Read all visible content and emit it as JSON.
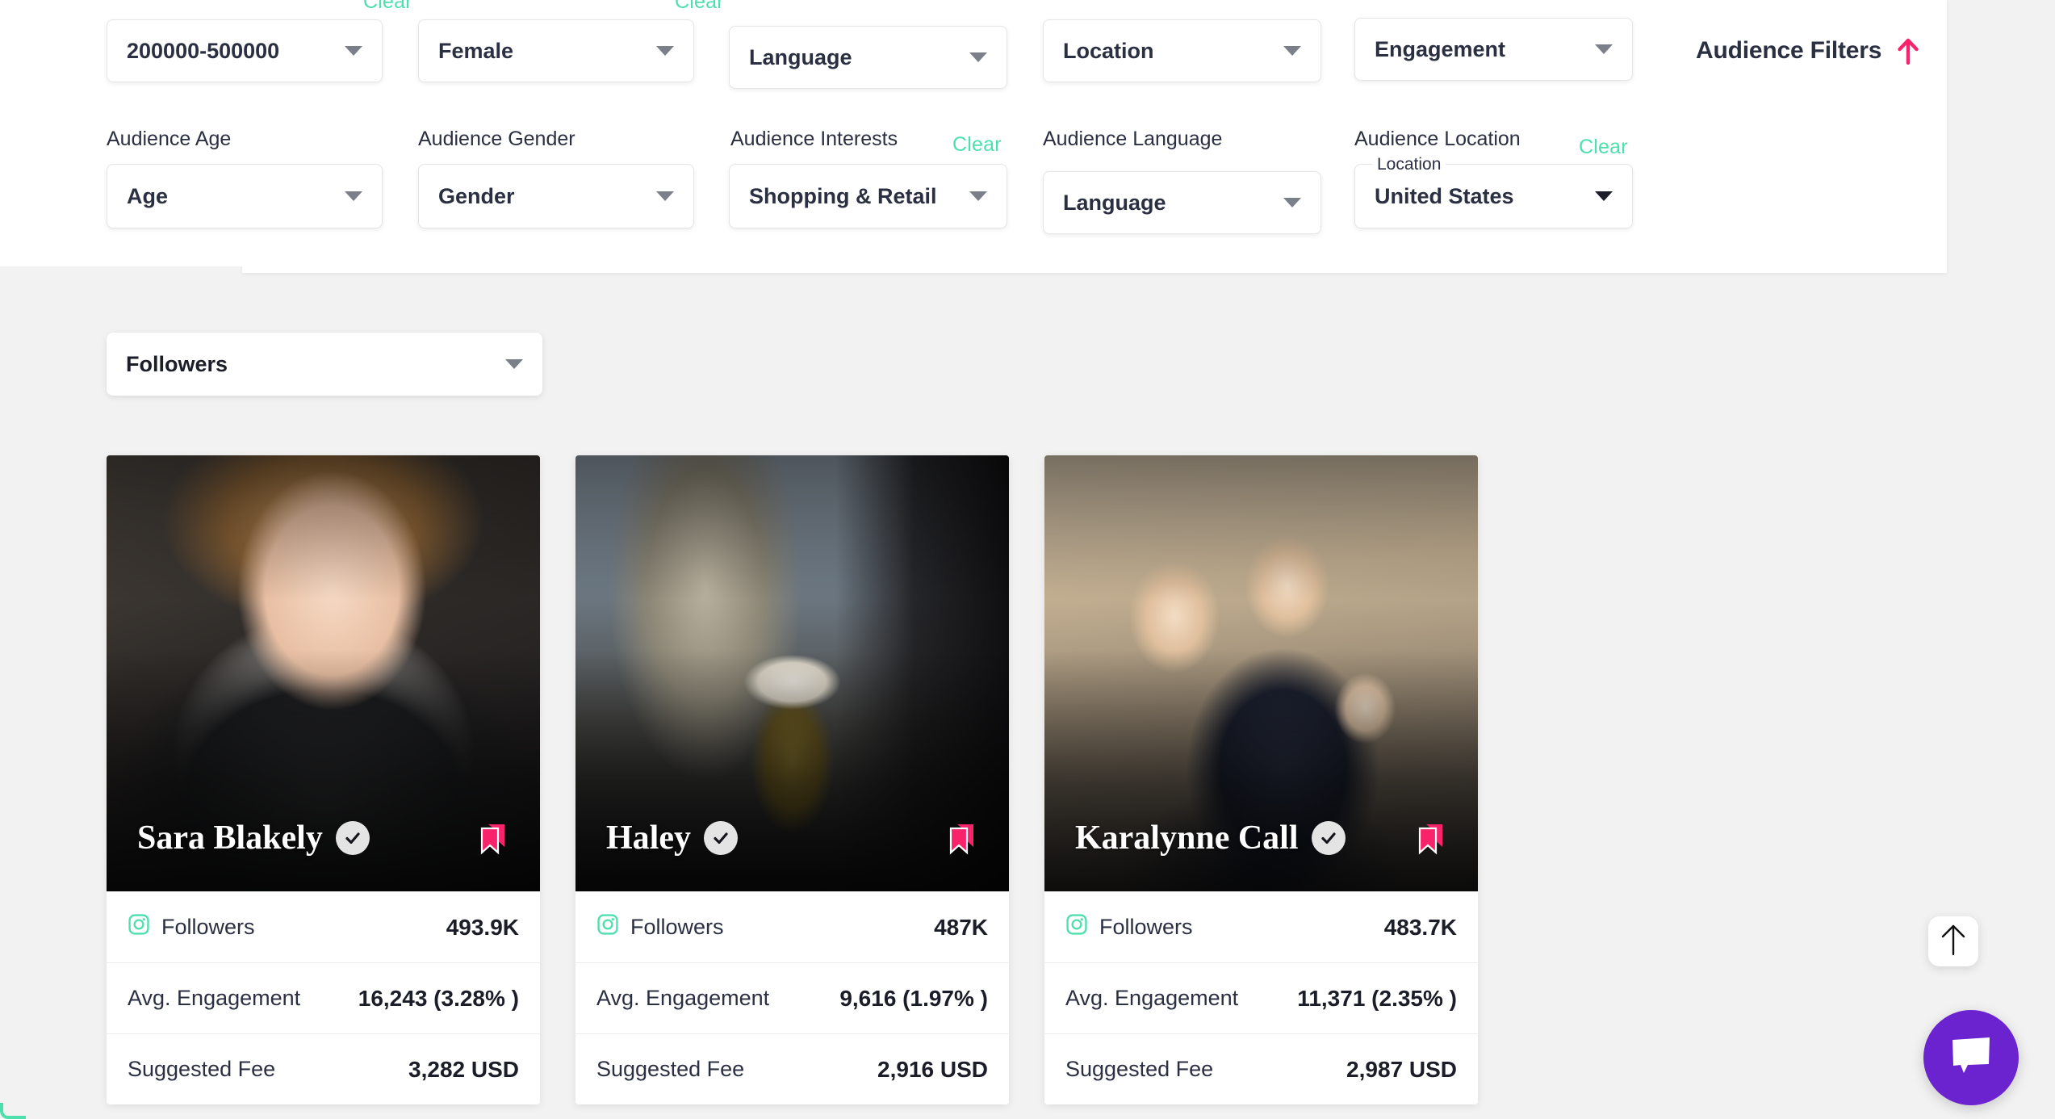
{
  "theme": {
    "accent_pink": "#f8236a",
    "accent_mint": "#4ee0ac",
    "text_dark": "#2b2f42",
    "chat_purple": "#6a23cf",
    "page_bg": "#f2f2f2"
  },
  "filters": {
    "clear_label": "Clear",
    "panel_title": "Audience Filters",
    "top_row": [
      {
        "name": "followers-range",
        "value": "200000-500000",
        "clear": true
      },
      {
        "name": "gender",
        "value": "Female",
        "clear": true
      },
      {
        "name": "language",
        "value": "Language",
        "clear": false
      },
      {
        "name": "location",
        "value": "Location",
        "clear": false
      },
      {
        "name": "engagement",
        "value": "Engagement",
        "clear": false
      }
    ],
    "bottom_row": [
      {
        "name": "audience-age",
        "label": "Audience Age",
        "value": "Age",
        "clear": false,
        "float_label": ""
      },
      {
        "name": "audience-gender",
        "label": "Audience Gender",
        "value": "Gender",
        "clear": false,
        "float_label": ""
      },
      {
        "name": "audience-interests",
        "label": "Audience Interests",
        "value": "Shopping & Retail",
        "clear": true,
        "float_label": ""
      },
      {
        "name": "audience-language",
        "label": "Audience Language",
        "value": "Language",
        "clear": false,
        "float_label": ""
      },
      {
        "name": "audience-location",
        "label": "Audience Location",
        "value": "United States",
        "clear": true,
        "float_label": "Location"
      }
    ]
  },
  "sort": {
    "value": "Followers"
  },
  "stat_labels": {
    "followers": "Followers",
    "engagement": "Avg. Engagement",
    "fee": "Suggested Fee"
  },
  "cards": [
    {
      "name": "Sara Blakely",
      "verified": true,
      "platform_icon": "instagram-icon",
      "followers": "493.9K",
      "engagement": "16,243 (3.28% )",
      "fee": "3,282 USD"
    },
    {
      "name": "Haley",
      "verified": true,
      "platform_icon": "instagram-icon",
      "followers": "487K",
      "engagement": "9,616 (1.97% )",
      "fee": "2,916 USD"
    },
    {
      "name": "Karalynne Call",
      "verified": true,
      "platform_icon": "instagram-icon",
      "followers": "483.7K",
      "engagement": "11,371 (2.35% )",
      "fee": "2,987 USD"
    }
  ]
}
